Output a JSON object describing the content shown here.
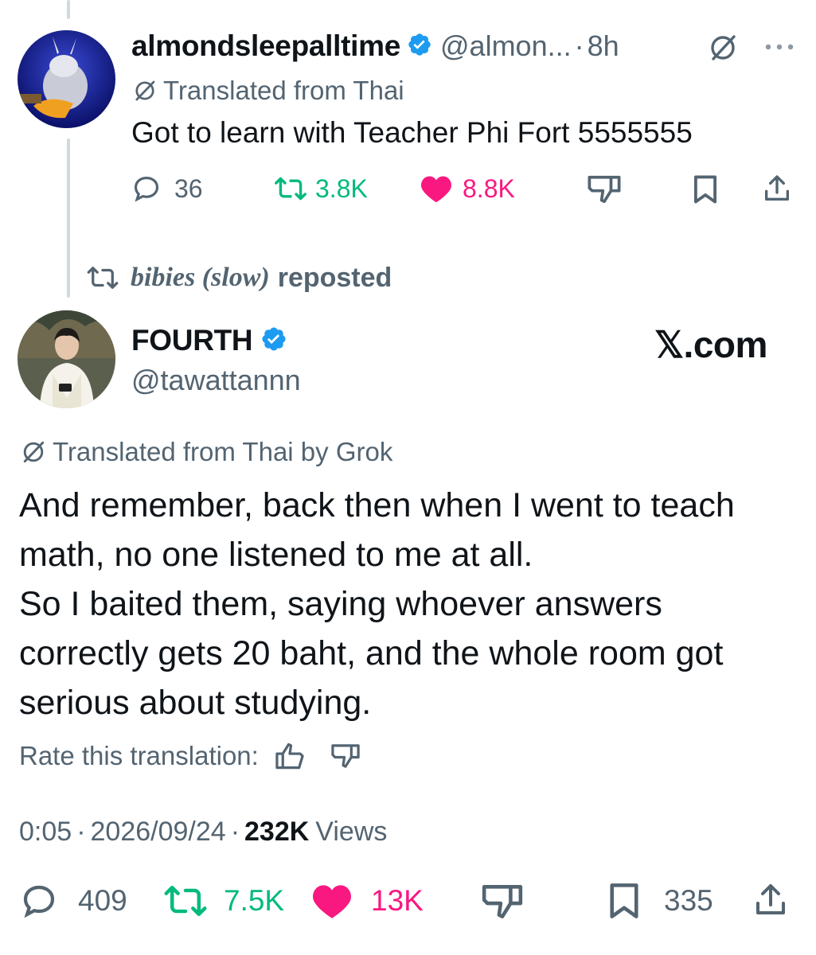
{
  "parent_tweet": {
    "display_name": "almondsleepalltime",
    "handle": "@almon...",
    "separator": "·",
    "time": "8h",
    "translated_label": "Translated from Thai",
    "text": "Got to learn with Teacher Phi Fort 5555555",
    "stats": {
      "replies": "36",
      "reposts": "3.8K",
      "likes": "8.8K"
    }
  },
  "repost_context": {
    "name": "bibies (slow)",
    "suffix": "reposted"
  },
  "main_tweet": {
    "display_name": "FOURTH",
    "handle": "@tawattannn",
    "watermark": "𝕏.com",
    "translated_label": "Translated from Thai by Grok",
    "text_lines": [
      "And remember, back then when I went to teach",
      "math, no one listened to me at all.",
      "So I baited them, saying whoever answers",
      "correctly gets 20 baht, and the whole room got",
      "serious about studying."
    ],
    "rate_label": "Rate this translation:",
    "timestamp": "0:05",
    "date": "2026/09/24",
    "views_count": "232K",
    "views_label": "Views",
    "sep": "·",
    "stats": {
      "replies": "409",
      "reposts": "7.5K",
      "likes": "13K",
      "bookmarks": "335"
    }
  },
  "colors": {
    "verified": "#1d9bf0",
    "repost": "#00ba7c",
    "like": "#f91880",
    "muted": "#536471"
  }
}
